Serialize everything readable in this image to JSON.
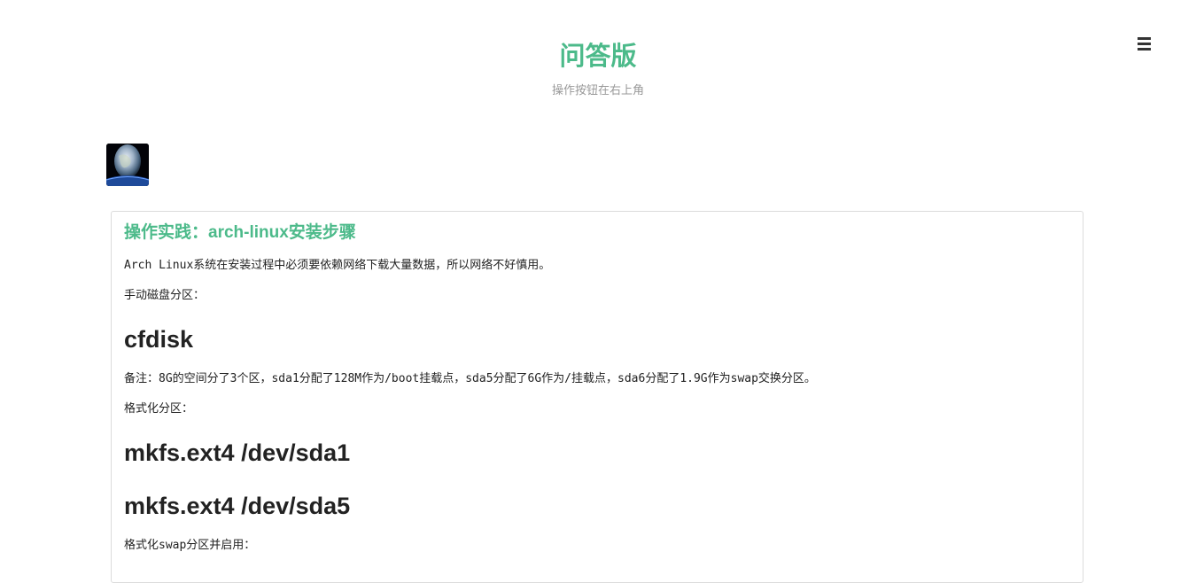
{
  "header": {
    "title": "问答版",
    "subtitle": "操作按钮在右上角",
    "menu_icon": "hamburger-icon"
  },
  "avatar": {
    "icon": "earth-avatar-image"
  },
  "post": {
    "title": "操作实践：arch-linux安装步骤",
    "intro": "Arch Linux系统在安装过程中必须要依赖网络下载大量数据，所以网络不好慎用。",
    "partition_label": "手动磁盘分区：",
    "cfdisk_heading": "cfdisk",
    "note": "备注：8G的空间分了3个区，sda1分配了128M作为/boot挂载点，sda5分配了6G作为/挂载点，sda6分配了1.9G作为swap交换分区。",
    "format_label": "格式化分区：",
    "mkfs_sda1": "mkfs.ext4 /dev/sda1",
    "mkfs_sda5": "mkfs.ext4 /dev/sda5",
    "swap_label": "格式化swap分区并启用："
  },
  "colors": {
    "accent": "#4cba8a",
    "subtitle": "#999999",
    "text": "#222222",
    "border": "#dcdcdc"
  }
}
